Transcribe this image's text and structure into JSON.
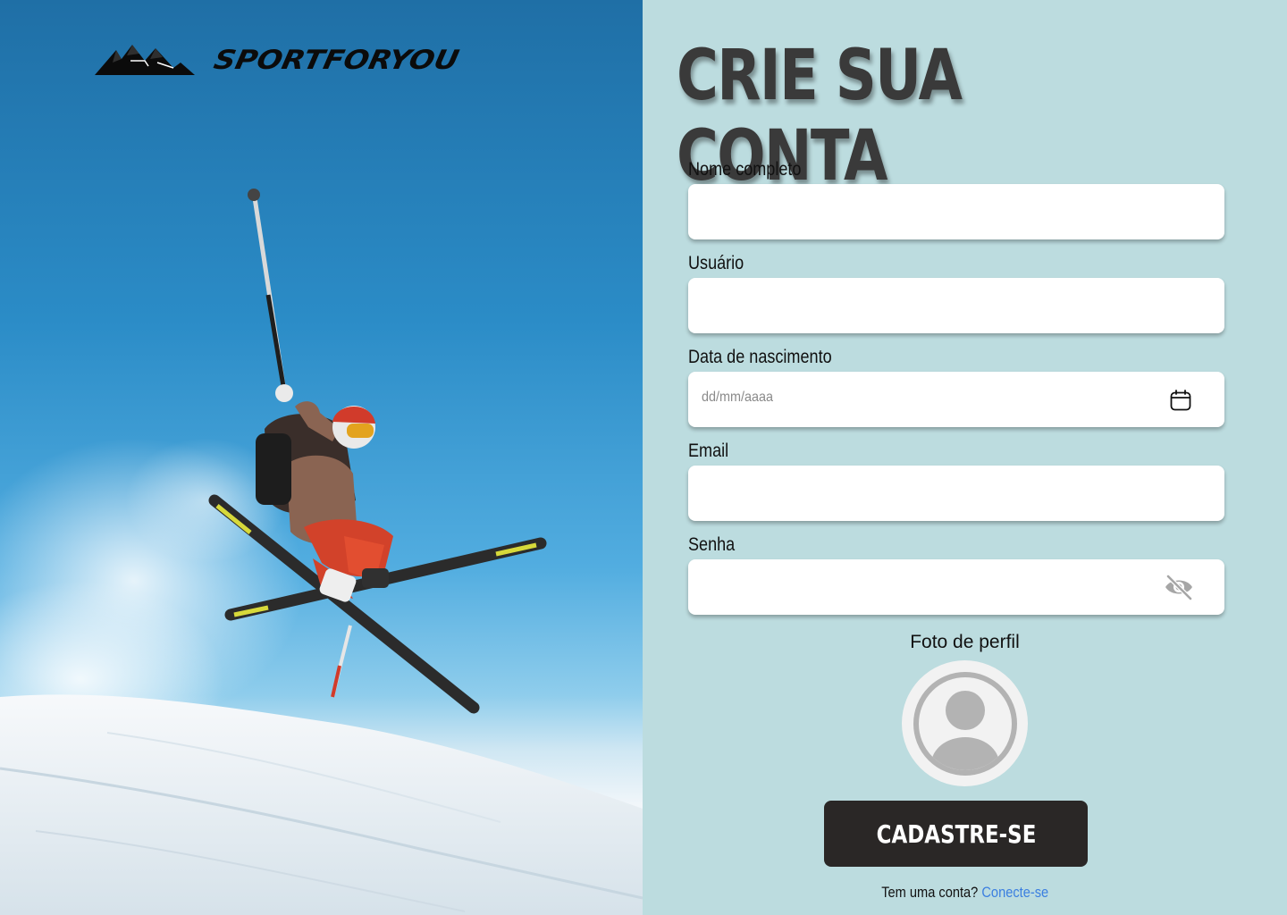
{
  "brand": {
    "name": "SPORTFORYOU",
    "logo_icon": "mountain-logo-icon"
  },
  "form": {
    "title": "CRIE SUA CONTA",
    "fields": {
      "full_name": {
        "label": "Nome completo",
        "value": ""
      },
      "username": {
        "label": "Usuário",
        "value": ""
      },
      "birth_date": {
        "label": "Data de nascimento",
        "placeholder": "dd/mm/aaaa",
        "icon": "calendar-icon"
      },
      "email": {
        "label": "Email",
        "value": ""
      },
      "password": {
        "label": "Senha",
        "value": "",
        "icon": "eye-off-icon"
      }
    },
    "profile_photo": {
      "label": "Foto de perfil",
      "icon": "user-avatar-icon"
    },
    "submit_label": "CADASTRE-SE",
    "login_prompt": "Tem uma conta?",
    "login_link": "Conecte-se"
  },
  "colors": {
    "panel_bg": "#bcdcdf",
    "button_bg": "#2a2726",
    "title": "#3a3a3a",
    "link": "#3b7fe0"
  }
}
